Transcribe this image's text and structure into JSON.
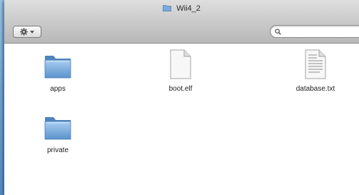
{
  "window": {
    "title": "Wii4_2"
  },
  "toolbar": {
    "search_placeholder": ""
  },
  "files": [
    {
      "name": "apps",
      "kind": "folder"
    },
    {
      "name": "boot.elf",
      "kind": "document"
    },
    {
      "name": "database.txt",
      "kind": "text-document"
    },
    {
      "name": "private",
      "kind": "folder"
    }
  ],
  "icons": {
    "action": "gear-icon",
    "search": "magnifier-icon",
    "folder": "folder-icon",
    "document": "blank-document-icon",
    "text_document": "text-document-icon"
  },
  "colors": {
    "folder_blue": "#6fa3d6",
    "desktop_blue": "#5f98cf"
  }
}
